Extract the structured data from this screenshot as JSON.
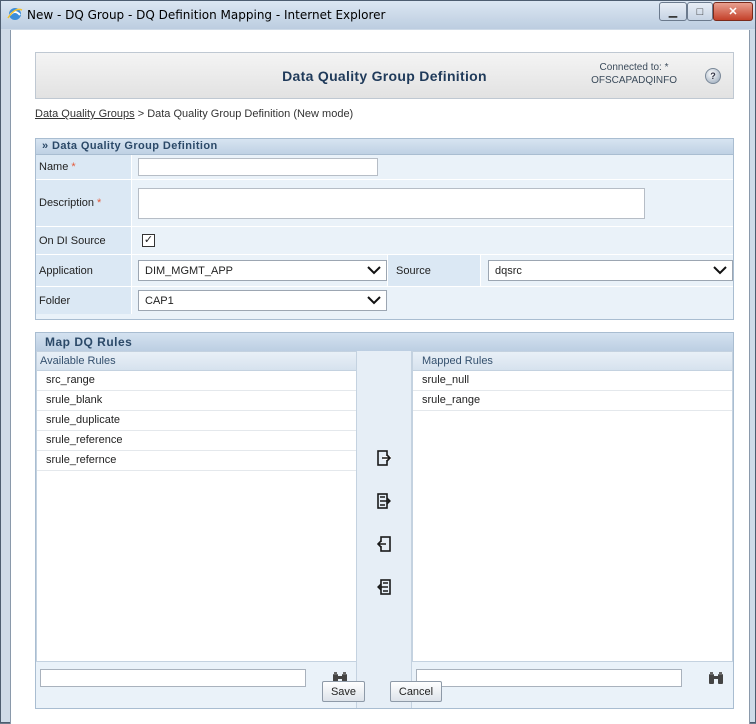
{
  "window": {
    "title": "New - DQ Group - DQ Definition Mapping - Internet Explorer"
  },
  "header": {
    "title": "Data Quality Group Definition",
    "connected_label": "Connected to:",
    "connected_value": "OFSCAPADQINFO",
    "connected_extra": "*"
  },
  "breadcrumb": {
    "link": "Data Quality Groups",
    "rest": " > Data Quality Group Definition (New mode)"
  },
  "definition": {
    "section_title": "» Data Quality Group Definition",
    "name_label": "Name",
    "name_value": "",
    "description_label": "Description",
    "description_value": "",
    "required_marker": "*",
    "on_di_source_label": "On DI Source",
    "on_di_source_checked": "✓",
    "application_label": "Application",
    "application_value": "DIM_MGMT_APP",
    "source_label": "Source",
    "source_value": "dqsrc",
    "folder_label": "Folder",
    "folder_value": "CAP1"
  },
  "map": {
    "section_title": "Map DQ Rules",
    "available_title": "Available Rules",
    "available_items": [
      "src_range",
      "srule_blank",
      "srule_duplicate",
      "srule_reference",
      "srule_refernce"
    ],
    "mapped_title": "Mapped Rules",
    "mapped_items": [
      "srule_null",
      "srule_range"
    ],
    "available_search_value": "",
    "mapped_search_value": ""
  },
  "buttons": {
    "save": "Save",
    "cancel": "Cancel"
  },
  "icons": {
    "titlebar": "internet-explorer-icon",
    "help": "help-icon",
    "move_selected": "move-right-icon",
    "move_all": "move-all-right-icon",
    "remove_selected": "move-left-icon",
    "remove_all": "move-all-left-icon",
    "search": "binoculars-icon"
  }
}
